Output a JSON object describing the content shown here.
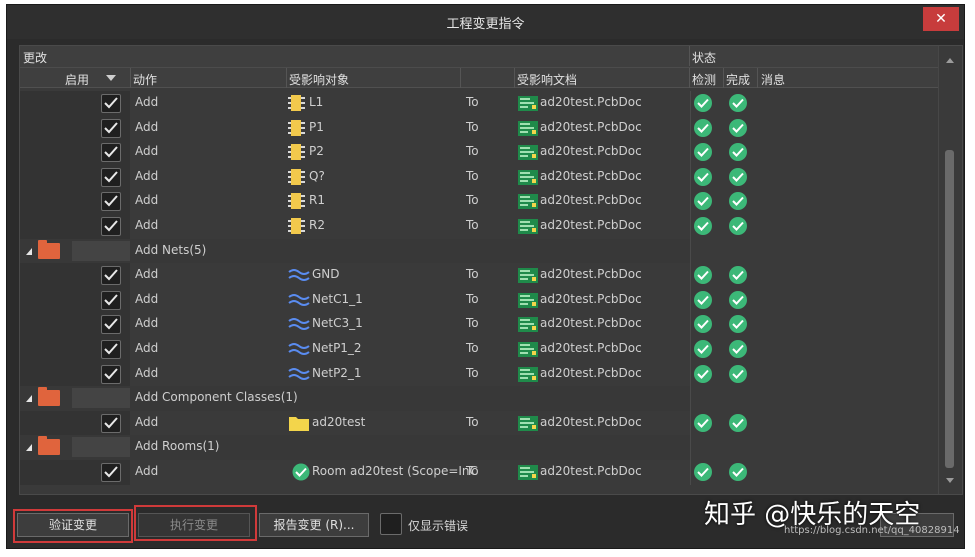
{
  "window": {
    "title": "工程变更指令",
    "close_glyph": "✕"
  },
  "headers": {
    "group_left": "更改",
    "group_status": "状态",
    "enable": "启用",
    "action": "动作",
    "affected_object": "受影响对象",
    "affected_doc": "受影响文档",
    "check": "检测",
    "done": "完成",
    "message": "消息"
  },
  "rows": [
    {
      "kind": "item",
      "action": "Add",
      "object": "L1",
      "icon": "component-icon",
      "to": "To",
      "doc": "ad20test.PcbDoc"
    },
    {
      "kind": "item",
      "action": "Add",
      "object": "P1",
      "icon": "component-icon",
      "to": "To",
      "doc": "ad20test.PcbDoc"
    },
    {
      "kind": "item",
      "action": "Add",
      "object": "P2",
      "icon": "component-icon",
      "to": "To",
      "doc": "ad20test.PcbDoc"
    },
    {
      "kind": "item",
      "action": "Add",
      "object": "Q?",
      "icon": "component-icon",
      "to": "To",
      "doc": "ad20test.PcbDoc"
    },
    {
      "kind": "item",
      "action": "Add",
      "object": "R1",
      "icon": "component-icon",
      "to": "To",
      "doc": "ad20test.PcbDoc"
    },
    {
      "kind": "item",
      "action": "Add",
      "object": "R2",
      "icon": "component-icon",
      "to": "To",
      "doc": "ad20test.PcbDoc"
    },
    {
      "kind": "group",
      "label": "Add Nets(5)"
    },
    {
      "kind": "item",
      "action": "Add",
      "object": "GND",
      "icon": "net-icon",
      "to": "To",
      "doc": "ad20test.PcbDoc"
    },
    {
      "kind": "item",
      "action": "Add",
      "object": "NetC1_1",
      "icon": "net-icon",
      "to": "To",
      "doc": "ad20test.PcbDoc"
    },
    {
      "kind": "item",
      "action": "Add",
      "object": "NetC3_1",
      "icon": "net-icon",
      "to": "To",
      "doc": "ad20test.PcbDoc"
    },
    {
      "kind": "item",
      "action": "Add",
      "object": "NetP1_2",
      "icon": "net-icon",
      "to": "To",
      "doc": "ad20test.PcbDoc"
    },
    {
      "kind": "item",
      "action": "Add",
      "object": "NetP2_1",
      "icon": "net-icon",
      "to": "To",
      "doc": "ad20test.PcbDoc"
    },
    {
      "kind": "group",
      "label": "Add Component Classes(1)"
    },
    {
      "kind": "item",
      "action": "Add",
      "object": "ad20test",
      "icon": "folder-icon",
      "to": "To",
      "doc": "ad20test.PcbDoc"
    },
    {
      "kind": "group",
      "label": "Add Rooms(1)"
    },
    {
      "kind": "item",
      "action": "Add",
      "object": "Room ad20test (Scope=InC",
      "icon": "room-icon",
      "to": "To",
      "doc": "ad20test.PcbDoc"
    }
  ],
  "footer": {
    "validate": "验证变更",
    "execute": "执行变更",
    "report": "报告变更 (R)...",
    "only_errors": "仅显示错误"
  },
  "watermark": {
    "brand": "知乎 @快乐的天空",
    "url": "https://blog.csdn.net/qq_40828914"
  },
  "colors": {
    "ok": "#3cb878",
    "highlight": "#d03a3a",
    "folder": "#e0643d"
  }
}
